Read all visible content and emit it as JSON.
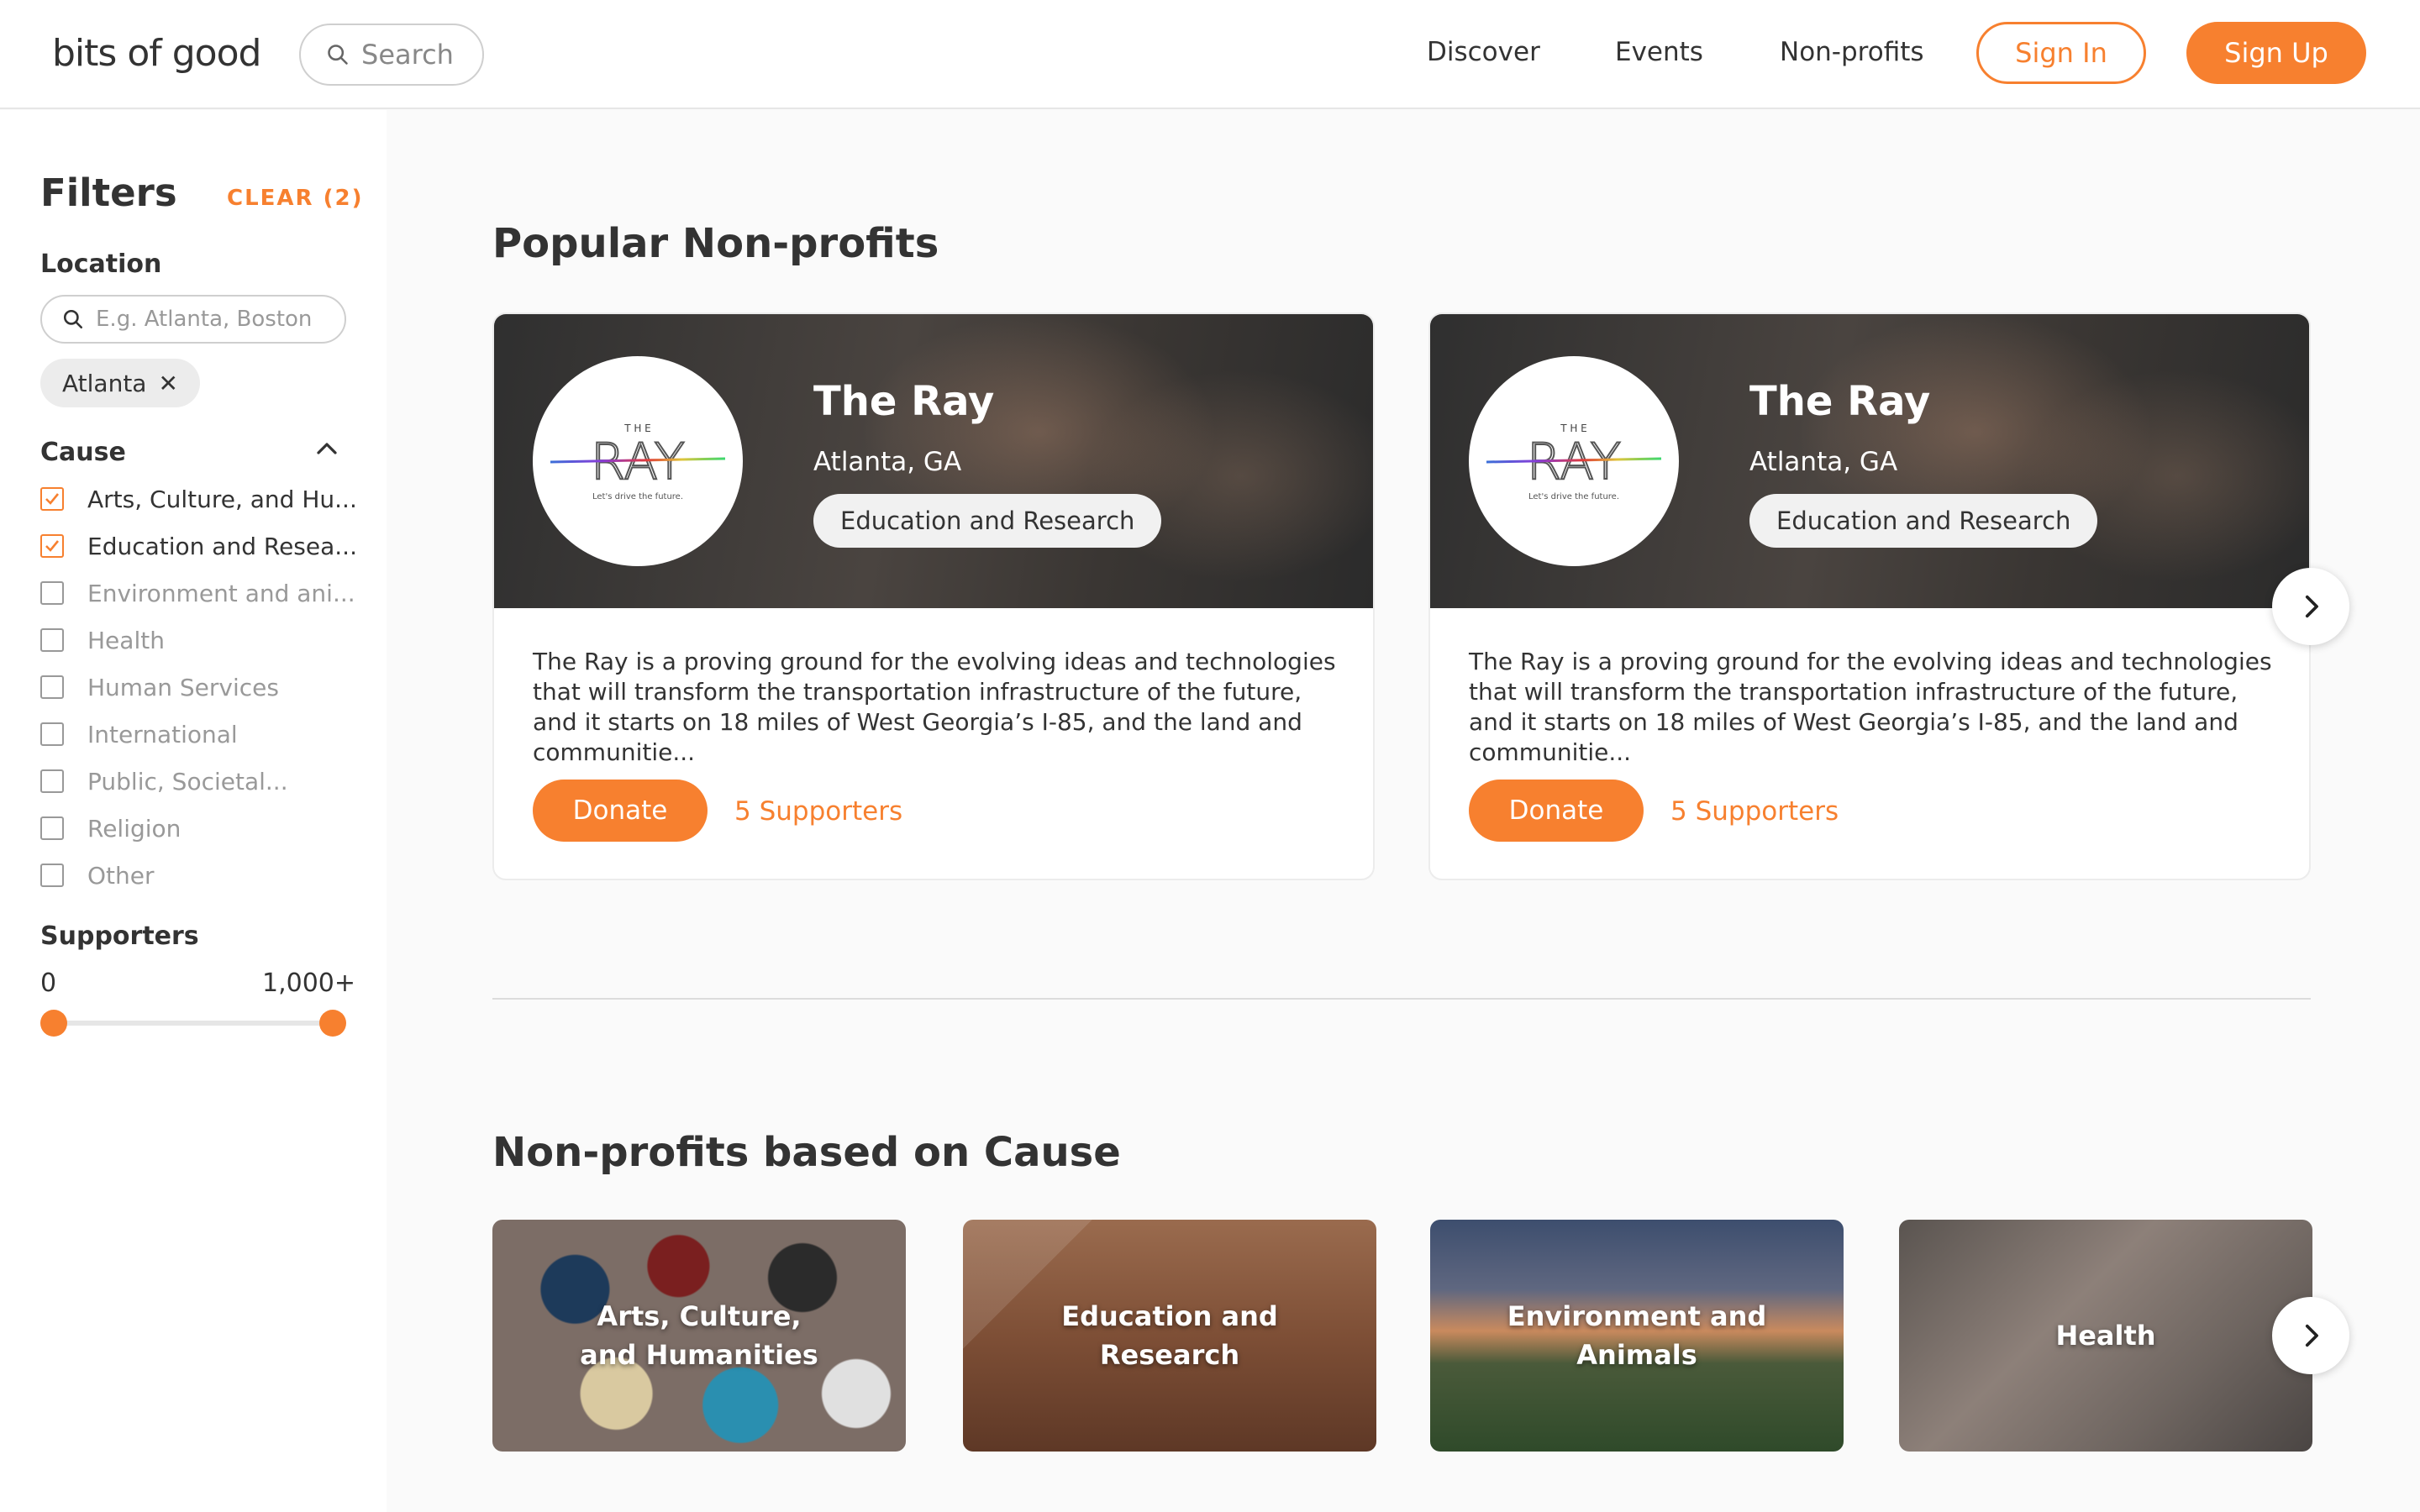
{
  "header": {
    "logo": "bits of good",
    "search_placeholder": "Search",
    "nav": [
      "Discover",
      "Events",
      "Non-profits"
    ],
    "sign_in": "Sign In",
    "sign_up": "Sign Up"
  },
  "sidebar": {
    "title": "Filters",
    "clear": "CLEAR (2)",
    "location_title": "Location",
    "location_placeholder": "E.g. Atlanta, Boston",
    "location_chip": "Atlanta",
    "cause_title": "Cause",
    "causes": [
      {
        "label": "Arts, Culture, and Hu...",
        "checked": true
      },
      {
        "label": "Education and Resea...",
        "checked": true
      },
      {
        "label": "Environment and ani...",
        "checked": false
      },
      {
        "label": "Health",
        "checked": false
      },
      {
        "label": "Human Services",
        "checked": false
      },
      {
        "label": "International",
        "checked": false
      },
      {
        "label": "Public, Societal...",
        "checked": false
      },
      {
        "label": "Religion",
        "checked": false
      },
      {
        "label": "Other",
        "checked": false
      }
    ],
    "supporters_title": "Supporters",
    "range_min": "0",
    "range_max": "1,000+"
  },
  "main": {
    "popular_title": "Popular Non-profits",
    "cards": [
      {
        "logo_top": "T H E",
        "logo_main": "RAY",
        "logo_tagline": "Let's drive the future.",
        "title": "The Ray",
        "location": "Atlanta, GA",
        "tag": "Education and Research",
        "description": "The Ray is a proving ground for the evolving ideas and technologies that will transform the transportation infrastructure of the future, and it starts on 18 miles of West Georgia’s I-85, and the land and communitie...",
        "donate": "Donate",
        "supporters": "5 Supporters"
      },
      {
        "logo_top": "T H E",
        "logo_main": "RAY",
        "logo_tagline": "Let's drive the future.",
        "title": "The Ray",
        "location": "Atlanta, GA",
        "tag": "Education and Research",
        "description": "The Ray is a proving ground for the evolving ideas and technologies that will transform the transportation infrastructure of the future, and it starts on 18 miles of West Georgia’s I-85, and the land and communitie...",
        "donate": "Donate",
        "supporters": "5 Supporters"
      }
    ],
    "cause_title": "Non-profits based on Cause",
    "cause_tiles": [
      "Arts, Culture, and Humanities",
      "Education and Research",
      "Environment and Animals",
      "Health"
    ]
  },
  "colors": {
    "accent": "#f7802f",
    "text": "#333333",
    "muted": "#999999"
  }
}
